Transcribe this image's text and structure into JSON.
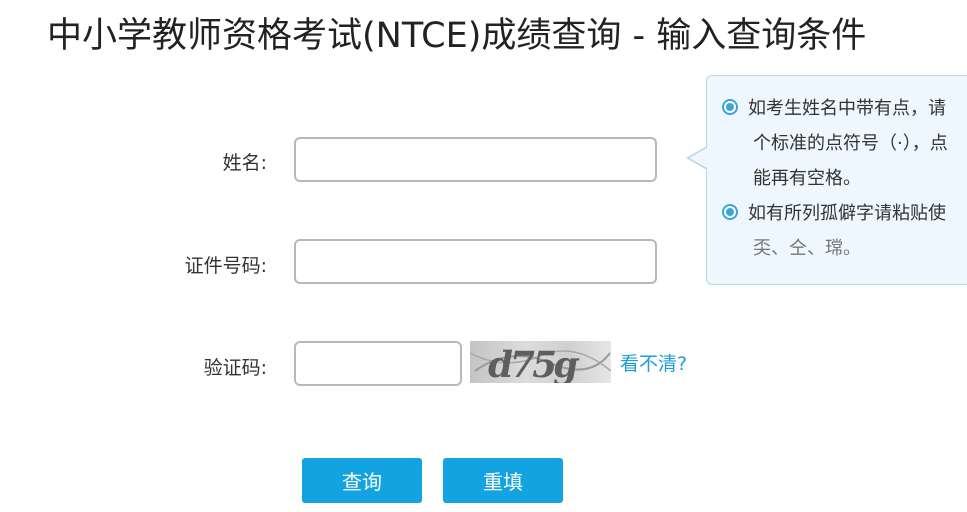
{
  "page": {
    "title": "中小学教师资格考试(NTCE)成绩查询 - 输入查询条件"
  },
  "form": {
    "name_label": "姓名:",
    "id_label": "证件号码:",
    "captcha_label": "验证码:",
    "name_value": "",
    "id_value": "",
    "captcha_value": "",
    "captcha_image_text": "d75g",
    "refresh_link": "看不清?",
    "query_button": "查询",
    "reset_button": "重填"
  },
  "tip": {
    "line1": "如考生姓名中带有点，请",
    "line2": "个标准的点符号（·），点",
    "line3": "能再有空格。",
    "line4": "如有所列孤僻字请粘贴使",
    "line5": "奀、仝、瑺。"
  },
  "colors": {
    "accent": "#12a3e0",
    "link": "#1c9ed8",
    "tip_bg": "#eef7fd",
    "tip_border": "#b9d7ea"
  }
}
